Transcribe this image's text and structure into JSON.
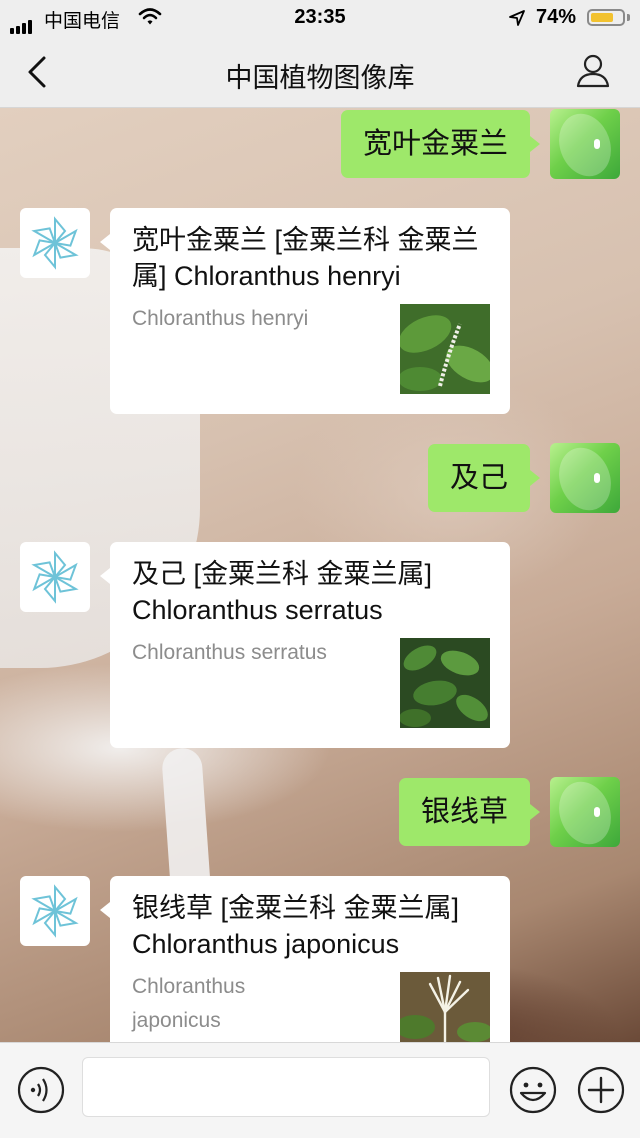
{
  "status_bar": {
    "carrier": "中国电信",
    "time": "23:35",
    "battery_percent": "74%",
    "battery_level": 0.74,
    "icons": [
      "signal-icon",
      "wifi-icon",
      "location-arrow-icon",
      "battery-icon"
    ]
  },
  "nav": {
    "title": "中国植物图像库",
    "back_icon": "chevron-left-icon",
    "profile_icon": "person-icon"
  },
  "messages": [
    {
      "query": "宽叶金粟兰",
      "result": {
        "title": "宽叶金粟兰 [金粟兰科 金粟兰属] Chloranthus henryi",
        "description": "Chloranthus henryi"
      }
    },
    {
      "query": "及己",
      "result": {
        "title": "及己 [金粟兰科 金粟兰属] Chloranthus serratus",
        "description": "Chloranthus serratus"
      }
    },
    {
      "query": "银线草",
      "result": {
        "title": "银线草 [金粟兰科 金粟兰属] Chloranthus japonicus",
        "description": "Chloranthus japonicus"
      }
    }
  ],
  "colors": {
    "user_bubble": "#9ee86a",
    "card_background": "#ffffff",
    "bar_background": "#eeeeee",
    "logo_blue": "#6ec3d8",
    "battery_fill": "#f2c230"
  },
  "input_bar": {
    "icons": [
      "voice-icon",
      "emoji-icon",
      "plus-icon"
    ]
  }
}
